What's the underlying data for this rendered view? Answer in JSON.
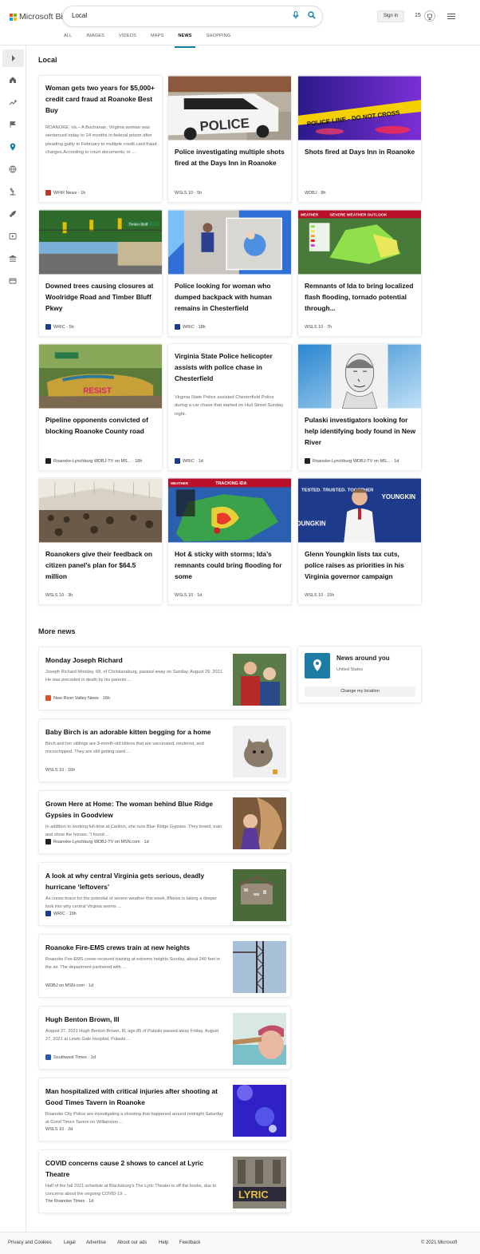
{
  "header": {
    "logo_text": "Microsoft Bing",
    "search_value": "Local",
    "sign_in": "Sign in",
    "points": "15"
  },
  "tabs": [
    "ALL",
    "IMAGES",
    "VIDEOS",
    "MAPS",
    "NEWS",
    "SHOPPING"
  ],
  "active_tab": "NEWS",
  "section_local": "Local",
  "local_cards": [
    {
      "title": "Woman gets two years for $5,000+ credit card fraud at Roanoke Best Buy",
      "desc": "ROANOKE, Va.– A Buchanan, Virginia woman was sentenced today to 24 months in federal prison after pleading guilty in February to multiple credit card fraud charges.According to court documents, in ...",
      "source": "WFIR News",
      "time": "1h"
    },
    {
      "title": "Police investigating multiple shots fired at the Days Inn in Roanoke",
      "source": "WSLS 10",
      "time": "5h"
    },
    {
      "title": "Shots fired at Days Inn in Roanoke",
      "source": "WDBJ",
      "time": "8h"
    },
    {
      "title": "Downed trees causing closures at Woolridge Road and Timber Bluff Pkwy",
      "source": "WRIC",
      "time": "5h"
    },
    {
      "title": "Police looking for woman who dumped backpack with human remains in Chesterfield",
      "source": "WRIC",
      "time": "18h"
    },
    {
      "title": "Remnants of Ida to bring localized flash flooding, tornado potential through...",
      "source": "WSLS 10",
      "time": "7h"
    },
    {
      "title": "Pipeline opponents convicted of blocking Roanoke County road",
      "source": "Roanoke-Lynchburg WDBJ-TV on MS...",
      "time": "18h"
    },
    {
      "title": "Virginia State Police helicopter assists with police chase in Chesterfield",
      "desc": "Virginia State Police assisted Chesterfield Police during a car chase that started on Hull Street Sunday night.",
      "source": "WRIC",
      "time": "1d"
    },
    {
      "title": "Pulaski investigators looking for help identifying body found in New River",
      "source": "Roanoke-Lynchburg WDBJ-TV on MS...",
      "time": "1d"
    },
    {
      "title": "Roanokers give their feedback on citizen panel’s plan for $64.5 million",
      "source": "WSLS 10",
      "time": "3h"
    },
    {
      "title": "Hot & sticky with storms; Ida’s remnants could bring flooding for some",
      "source": "WSLS 10",
      "time": "1d"
    },
    {
      "title": "Glenn Youngkin lists tax cuts, police raises as priorities in his Virginia governor campaign",
      "source": "WSLS 10",
      "time": "15h"
    }
  ],
  "image_text": {
    "police_car": "POLICE",
    "tape": "POLICE LINE - DO NOT CROSS",
    "street_sign": "Timber Bluff",
    "weather_outlook": "SEVERE WEATHER OUTLOOK",
    "weather_brand": "WEATHER",
    "tracking": "TRACKING IDA",
    "resist": "RESIST",
    "youngkin": "YOUNGKIN",
    "tested": "TESTED. TRUSTED. TOGETHER",
    "lyric": "LYRIC"
  },
  "section_more": "More news",
  "more_news": [
    {
      "title": "Monday Joseph Richard",
      "desc": "Joseph Richard Monday, 68, of Christiansburg, passed away on Sunday, August 29, 2021. He was preceded in death by his parents ...",
      "source": "New River Valley News",
      "time": "16h"
    },
    {
      "title": "Baby Birch is an adorable kitten begging for a home",
      "desc": "Birch and her siblings are 3-month-old kittens that are vaccinated, neutered, and microchipped. They are still getting used ...",
      "source": "WSLS 10",
      "time": "16h"
    },
    {
      "title": "Grown Here at Home: The woman behind Blue Ridge Gypsies in Goodview",
      "desc": "In addition to working full-time at Carilion, she runs Blue Ridge Gypsies. They breed, train and show the horses. “I found ...",
      "source": "Roanoke-Lynchburg WDBJ-TV on MSN.com",
      "time": "1d"
    },
    {
      "title": "A look at why central Virginia gets serious, deadly hurricane ‘leftovers’",
      "desc": "As crews brace for the potential of severe weather this week, 8News is taking a deeper look into why central Virginia seems ...",
      "source": "WRIC",
      "time": "19h"
    },
    {
      "title": "Roanoke Fire-EMS crews train at new heights",
      "desc": "Roanoke Fire-EMS crews received training at extreme heights Sunday, about 240 feet in the air. The department partnered with ...",
      "source": "WDBJ on MSN.com",
      "time": "1d"
    },
    {
      "title": "Hugh Benton Brown, III",
      "desc": "August 27, 2021 Hugh Benton Brown, III, age 85 of Pulaski passed away Friday, August 27, 2021 at Lewis Gale Hospital, Pulaski ...",
      "source": "Southwest Times",
      "time": "1d"
    },
    {
      "title": "Man hospitalized with critical injuries after shooting at Good Times Tavern in Roanoke",
      "desc": "Roanoke City Police are investigating a shooting that happened around midnight Saturday at Good Times Tavern on Williamson ...",
      "source": "WSLS 10",
      "time": "2d"
    },
    {
      "title": "COVID concerns cause 2 shows to cancel at Lyric Theatre",
      "desc": "Half of the fall 2021 schedule at Blacksburg’s The Lyric Theater is off the books, due to concerns about the ongoing COVID-19 ...",
      "source": "The Roanoke Times",
      "time": "1d"
    }
  ],
  "news_around": {
    "title": "News around you",
    "location": "United States",
    "button": "Change my location"
  },
  "footer": {
    "links": [
      "Privacy and Cookies",
      "Legal",
      "Advertise",
      "About our ads",
      "Help",
      "Feedback"
    ],
    "copyright": "© 2021 Microsoft"
  }
}
